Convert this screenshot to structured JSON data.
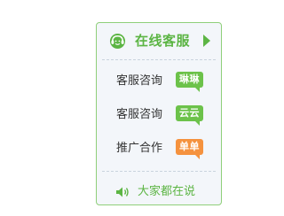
{
  "panel": {
    "title": "在线客服",
    "accent_color": "#5cb544",
    "border_color": "#8fcf7a",
    "icons": {
      "header": "customer-service-icon",
      "collapse": "triangle-right-icon",
      "footer": "speaker-icon"
    }
  },
  "contacts": [
    {
      "label": "客服咨询",
      "badge": "琳琳",
      "badge_color": "#6cc24a"
    },
    {
      "label": "客服咨询",
      "badge": "云云",
      "badge_color": "#6cc24a"
    },
    {
      "label": "推广合作",
      "badge": "单单",
      "badge_color": "#f5923e"
    }
  ],
  "footer": {
    "label": "大家都在说"
  }
}
